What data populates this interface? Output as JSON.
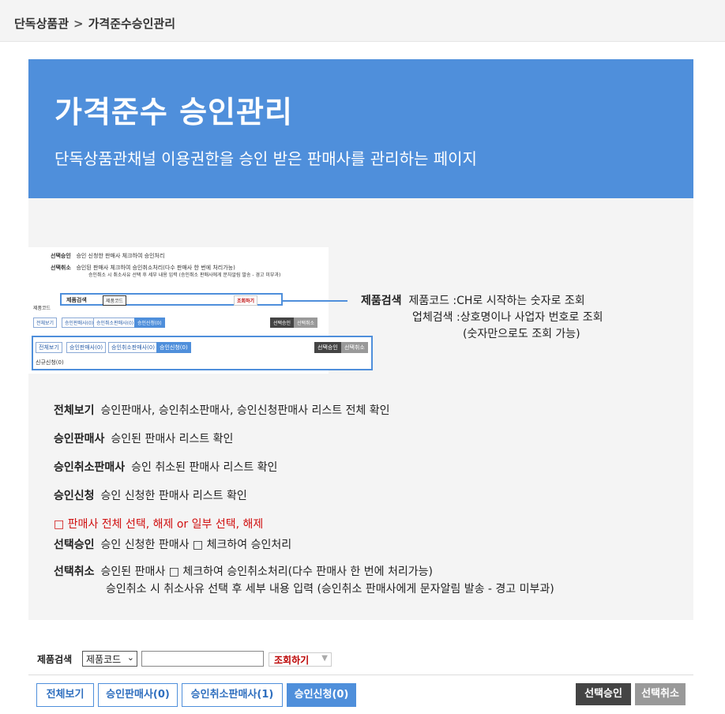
{
  "breadcrumb": {
    "root": "단독상품관",
    "separator": ">",
    "current": "가격준수승인관리"
  },
  "hero": {
    "title": "가격준수 승인관리",
    "subtitle": "단독상품관채널 이용권한을 승인 받은 판매사를 관리하는 페이지",
    "bg_color": "#4f8fdb"
  },
  "guide_image": {
    "line1_term": "선택승인",
    "line1_text": "승인 신청한 판매사 체크하여 승인처리",
    "line2_term": "선택취소",
    "line2_text": "승인된 판매사 체크하여 승인취소처리(다수 판매사 한 번에 처리가능)",
    "line3_text": "승인취소 시 취소사유 선택 후 세부 내용 입력 (승인취소 판매사에게 문자알림 발송 - 경고 미부과)",
    "search_label": "제품검색",
    "search_select": "제품코드",
    "search_button": "조회하기",
    "tabs": [
      "전체보기",
      "승인판매사(0)",
      "승인취소판매사(0)",
      "승인신청(0)"
    ],
    "approve": "선택승인",
    "cancel": "선택취소",
    "pending": "신규신청(0)",
    "small_label": "제품코드"
  },
  "callout": {
    "title": "제품검색",
    "l1_term": "제품코드 :",
    "l1_text": "CH로 시작하는 숫자로 조회",
    "l2_term": "업체검색 :",
    "l2_text": "상호명이나 사업자 번호로 조회",
    "l3_text": "(숫자만으로도 조회 가능)"
  },
  "definitions": {
    "all_term": "전체보기",
    "all_text": "승인판매사, 승인취소판매사, 승인신청판매사 리스트 전체 확인",
    "approved_term": "승인판매사",
    "approved_text": "승인된 판매사 리스트 확인",
    "canceled_term": "승인취소판매사",
    "canceled_text": "승인 취소된 판매사 리스트 확인",
    "request_term": "승인신청",
    "request_text": "승인 신청한 판매사 리스트 확인",
    "note": "□ 판매사 전체 선택, 해제 or 일부 선택, 해제",
    "approve_term": "선택승인",
    "approve_text": "승인 신청한 판매사 □ 체크하여 승인처리",
    "cancel_term": "선택취소",
    "cancel_text1": "승인된 판매사 □ 체크하여 승인취소처리(다수 판매사 한 번에 처리가능)",
    "cancel_text2": "승인취소 시 취소사유 선택 후 세부 내용 입력 (승인취소 판매사에게 문자알림 발송 - 경고 미부과)"
  },
  "search": {
    "label": "제품검색",
    "select_value": "제품코드",
    "input_value": "",
    "button": "조회하기"
  },
  "tabs": [
    {
      "label": "전체보기",
      "active": false
    },
    {
      "label": "승인판매사(0)",
      "active": false
    },
    {
      "label": "승인취소판매사(1)",
      "active": false
    },
    {
      "label": "승인신청(0)",
      "active": true
    }
  ],
  "actions": {
    "approve": "선택승인",
    "cancel": "선택취소",
    "approve_color": "#444444",
    "cancel_color": "#999999"
  }
}
